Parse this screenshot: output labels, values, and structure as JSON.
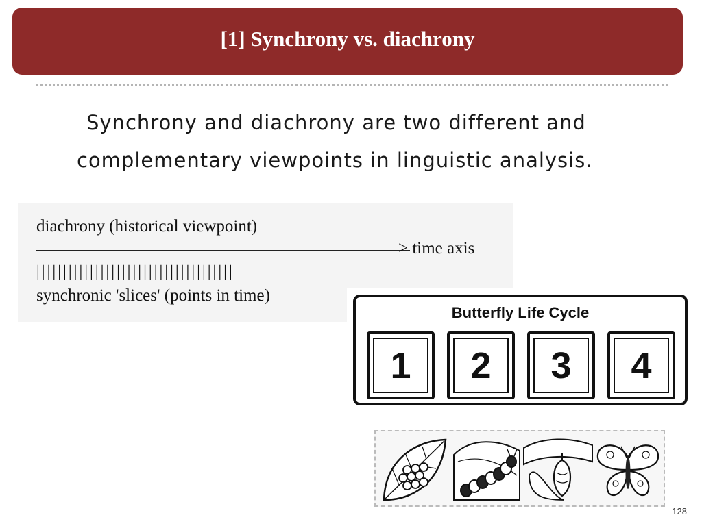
{
  "slide": {
    "title": "[1] Synchrony vs. diachrony",
    "intro_line1": "Synchrony and diachrony are two different and",
    "intro_line2": "complementary viewpoints in linguistic analysis.",
    "page_number": "128"
  },
  "diagram": {
    "line1": "diachrony (historical viewpoint)",
    "axis_label": "> time axis",
    "ticks": "|||||||||||||||||||||||||||||||||||||",
    "line3": "synchronic 'slices' (points in time)"
  },
  "lifecycle": {
    "title": "Butterfly Life Cycle",
    "numbers": [
      "1",
      "2",
      "3",
      "4"
    ],
    "stages": [
      "eggs-on-leaf",
      "caterpillar",
      "chrysalis",
      "butterfly"
    ]
  },
  "colors": {
    "title_bar": "#8e2a29",
    "title_text": "#ffffff"
  }
}
